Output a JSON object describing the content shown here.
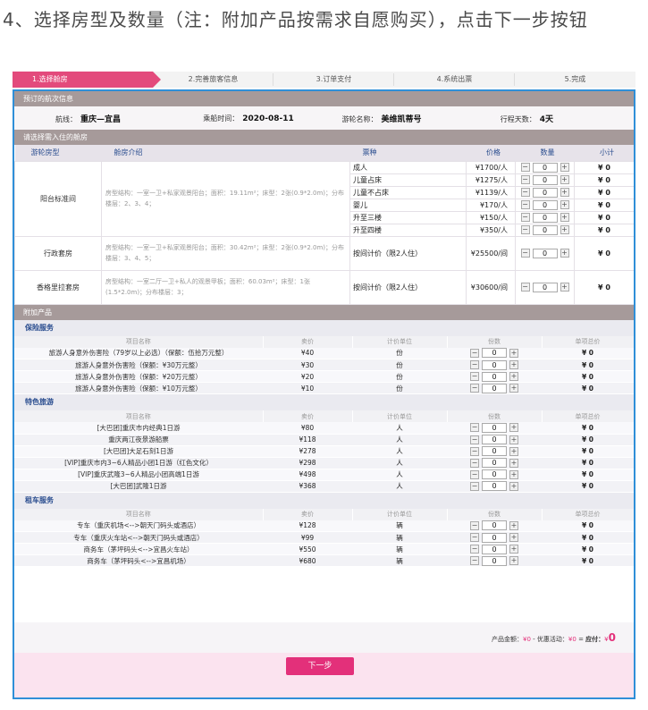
{
  "caption": "4、选择房型及数量（注：附加产品按需求自愿购买），点击下一步按钮",
  "steps": [
    "1.选择舱房",
    "2.完善旅客信息",
    "3.订单支付",
    "4.系统出票",
    "5.完成"
  ],
  "voyage": {
    "title": "预订的航次信息",
    "route_label": "航线：",
    "route": "重庆—宜昌",
    "date_label": "乘船时间：",
    "date": "2020-08-11",
    "ship_label": "游轮名称：",
    "ship": "美维凯蒂号",
    "days_label": "行程天数：",
    "days": "4天"
  },
  "cabins": {
    "title": "请选择需入住的舱房",
    "headers": [
      "游轮房型",
      "舱房介绍",
      "票种",
      "价格",
      "数量",
      "小计"
    ],
    "rooms": [
      {
        "name": "阳台标准间",
        "intro": "房型结构：一室一卫+私家观景阳台；面积：19.11m²；床型：2张(0.9*2.0m)；分布楼层：2、3、4；",
        "tickets": [
          {
            "type": "成人",
            "price": "¥1700/人",
            "qty": "0",
            "sub": "¥ 0"
          },
          {
            "type": "儿童占床",
            "price": "¥1275/人",
            "qty": "0",
            "sub": "¥ 0"
          },
          {
            "type": "儿童不占床",
            "price": "¥1139/人",
            "qty": "0",
            "sub": "¥ 0"
          },
          {
            "type": "婴儿",
            "price": "¥170/人",
            "qty": "0",
            "sub": "¥ 0"
          },
          {
            "type": "升至三楼",
            "price": "¥150/人",
            "qty": "0",
            "sub": "¥ 0"
          },
          {
            "type": "升至四楼",
            "price": "¥350/人",
            "qty": "0",
            "sub": "¥ 0"
          }
        ]
      },
      {
        "name": "行政套房",
        "intro": "房型结构：一室一卫+私家观景阳台；面积：30.42m²；床型：2张(0.9*2.0m)；分布楼层：3、4、5；",
        "tickets": [
          {
            "type": "按间计价（限2人住）",
            "price": "¥25500/间",
            "qty": "0",
            "sub": "¥ 0"
          }
        ]
      },
      {
        "name": "香格里拉套房",
        "intro": "房型结构：一室二厅一卫+私人的观景甲板；面积：60.03m²；床型：1张(1.5*2.0m)；分布楼层：3；",
        "tickets": [
          {
            "type": "按间计价（限2人住）",
            "price": "¥30600/间",
            "qty": "0",
            "sub": "¥ 0"
          }
        ]
      }
    ]
  },
  "addons": {
    "title": "附加产品",
    "columns": [
      "项目名称",
      "卖价",
      "计价单位",
      "份数",
      "单项总价"
    ],
    "categories": [
      {
        "title": "保险服务",
        "items": [
          {
            "name": "旅游人身意外伤害险（79岁以上必选）（保额：伍拾万元整）",
            "price": "¥40",
            "unit": "份",
            "qty": "0",
            "sum": "¥ 0"
          },
          {
            "name": "旅游人身意外伤害险（保额：¥30万元整）",
            "price": "¥30",
            "unit": "份",
            "qty": "0",
            "sum": "¥ 0"
          },
          {
            "name": "旅游人身意外伤害险（保额：¥20万元整）",
            "price": "¥20",
            "unit": "份",
            "qty": "0",
            "sum": "¥ 0"
          },
          {
            "name": "旅游人身意外伤害险（保额：¥10万元整）",
            "price": "¥10",
            "unit": "份",
            "qty": "0",
            "sum": "¥ 0"
          }
        ]
      },
      {
        "title": "特色旅游",
        "items": [
          {
            "name": "[大巴团]重庆市内经典1日游",
            "price": "¥80",
            "unit": "人",
            "qty": "0",
            "sum": "¥ 0"
          },
          {
            "name": "重庆两江夜景游船票",
            "price": "¥118",
            "unit": "人",
            "qty": "0",
            "sum": "¥ 0"
          },
          {
            "name": "[大巴团]大足石刻1日游",
            "price": "¥278",
            "unit": "人",
            "qty": "0",
            "sum": "¥ 0"
          },
          {
            "name": "[VIP]重庆市内3~6人精品小团1日游（红色文化）",
            "price": "¥298",
            "unit": "人",
            "qty": "0",
            "sum": "¥ 0"
          },
          {
            "name": "[VIP]重庆武隆3~6人精品小团高端1日游",
            "price": "¥498",
            "unit": "人",
            "qty": "0",
            "sum": "¥ 0"
          },
          {
            "name": "[大巴团]武隆1日游",
            "price": "¥368",
            "unit": "人",
            "qty": "0",
            "sum": "¥ 0"
          }
        ]
      },
      {
        "title": "租车服务",
        "items": [
          {
            "name": "专车（重庆机场<-->朝天门码头或酒店）",
            "price": "¥128",
            "unit": "辆",
            "qty": "0",
            "sum": "¥ 0"
          },
          {
            "name": "专车（重庆火车站<-->朝天门码头或酒店）",
            "price": "¥99",
            "unit": "辆",
            "qty": "0",
            "sum": "¥ 0"
          },
          {
            "name": "商务车（茅坪码头<-->宜昌火车站）",
            "price": "¥550",
            "unit": "辆",
            "qty": "0",
            "sum": "¥ 0"
          },
          {
            "name": "商务车（茅坪码头<-->宜昌机场）",
            "price": "¥680",
            "unit": "辆",
            "qty": "0",
            "sum": "¥ 0"
          }
        ]
      }
    ]
  },
  "summary": {
    "amount_label": "产品金额：",
    "amount": "¥0",
    "discount_label": "- 优惠活动：",
    "discount": "¥0",
    "equals": "=",
    "payable_label": "应付：",
    "payable_currency": "¥",
    "payable": "0",
    "next_button": "下一步"
  },
  "stepper": {
    "minus": "−",
    "plus": "+"
  }
}
